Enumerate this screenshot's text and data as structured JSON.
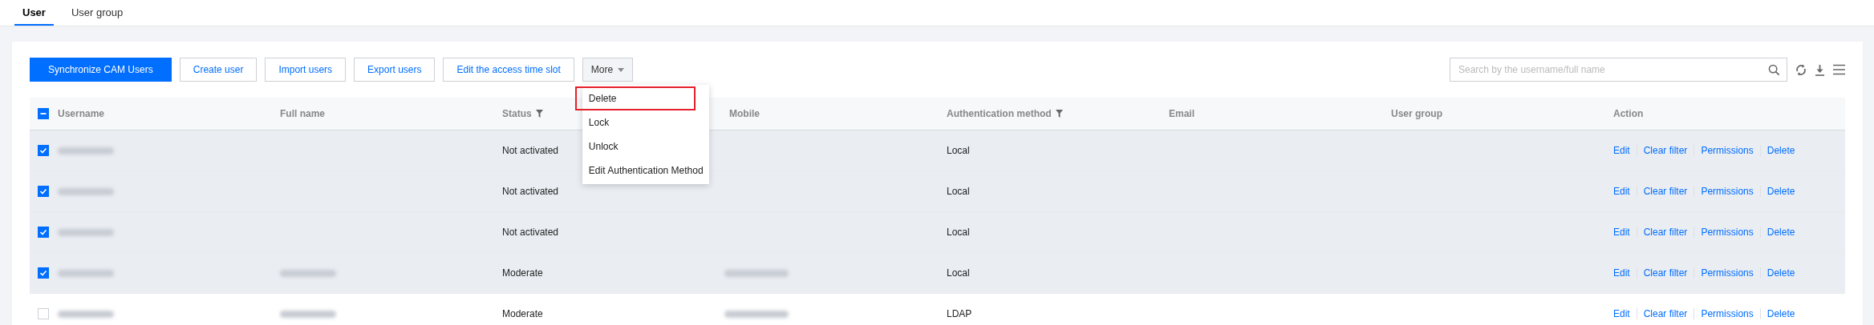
{
  "tabs": [
    {
      "label": "User",
      "selected": true
    },
    {
      "label": "User group",
      "selected": false
    }
  ],
  "toolbar": {
    "buttons": [
      {
        "label": "Synchronize CAM Users",
        "kind": "primary"
      },
      {
        "label": "Create user",
        "kind": "default"
      },
      {
        "label": "Import users",
        "kind": "default"
      },
      {
        "label": "Export users",
        "kind": "default"
      },
      {
        "label": "Edit the access time slot",
        "kind": "default"
      },
      {
        "label": "More",
        "kind": "dropdown"
      }
    ],
    "more_menu": {
      "items": [
        {
          "label": "Delete",
          "highlighted": true
        },
        {
          "label": "Lock",
          "highlighted": false
        },
        {
          "label": "Unlock",
          "highlighted": false
        },
        {
          "label": "Edit Authentication Method",
          "highlighted": false
        }
      ]
    },
    "search": {
      "placeholder": "Search by the username/full name"
    }
  },
  "table": {
    "header_checkbox": {
      "indeterminate": true
    },
    "columns": [
      {
        "label": "Username",
        "filter": false
      },
      {
        "label": "Full name",
        "filter": false
      },
      {
        "label": "Status",
        "filter": true
      },
      {
        "label": "Mobile",
        "filter": false
      },
      {
        "label": "Authentication method",
        "filter": true
      },
      {
        "label": "Email",
        "filter": false
      },
      {
        "label": "User group",
        "filter": false
      },
      {
        "label": "Action",
        "filter": false
      }
    ],
    "rows": [
      {
        "selected": true,
        "username_redacted": true,
        "full_name_redacted": false,
        "status": "Not activated",
        "mobile_redacted": false,
        "auth": "Local",
        "actions": [
          "Edit",
          "Clear filter",
          "Permissions",
          "Delete"
        ]
      },
      {
        "selected": true,
        "username_redacted": true,
        "full_name_redacted": false,
        "status": "Not activated",
        "mobile_redacted": false,
        "auth": "Local",
        "actions": [
          "Edit",
          "Clear filter",
          "Permissions",
          "Delete"
        ]
      },
      {
        "selected": true,
        "username_redacted": true,
        "full_name_redacted": false,
        "status": "Not activated",
        "mobile_redacted": false,
        "auth": "Local",
        "actions": [
          "Edit",
          "Clear filter",
          "Permissions",
          "Delete"
        ]
      },
      {
        "selected": true,
        "username_redacted": true,
        "full_name_redacted": true,
        "status": "Moderate",
        "mobile_redacted": true,
        "auth": "Local",
        "actions": [
          "Edit",
          "Clear filter",
          "Permissions",
          "Delete"
        ]
      },
      {
        "selected": false,
        "username_redacted": true,
        "full_name_redacted": true,
        "status": "Moderate",
        "mobile_redacted": true,
        "auth": "LDAP",
        "actions": [
          "Edit",
          "Clear filter",
          "Permissions",
          "Delete"
        ]
      }
    ]
  }
}
